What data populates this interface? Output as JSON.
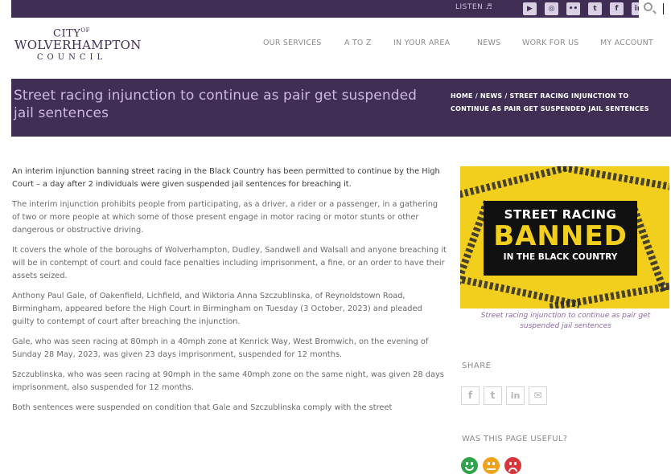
{
  "topbar": {
    "listen_label": "LISTEN",
    "socials": [
      {
        "name": "youtube-icon",
        "glyph": "▶"
      },
      {
        "name": "instagram-icon",
        "glyph": "◎"
      },
      {
        "name": "flickr-icon",
        "glyph": "••"
      },
      {
        "name": "twitter-icon",
        "glyph": "t"
      },
      {
        "name": "facebook-icon",
        "glyph": "f"
      },
      {
        "name": "linkedin-icon",
        "glyph": "in"
      }
    ]
  },
  "logo": {
    "line1": "CITY",
    "line1_of": "OF",
    "line2": "WOLVERHAMPTON",
    "line3": "COUNCIL"
  },
  "nav": {
    "items": [
      "OUR SERVICES",
      "A TO Z",
      "IN YOUR AREA",
      "NEWS",
      "WORK FOR US",
      "MY ACCOUNT"
    ]
  },
  "banner": {
    "title": "Street racing injunction to continue as pair get suspended jail sentences",
    "breadcrumb": "HOME  /  NEWS  /  STREET RACING INJUNCTION TO CONTINUE AS PAIR GET SUSPENDED JAIL SENTENCES"
  },
  "article": {
    "paragraphs": [
      "An interim injunction banning street racing in the Black Country has been permitted to continue by the High Court – a day after 2 individuals were given suspended jail sentences for breaching it.",
      "The interim injunction prohibits people from participating, as a driver, a rider or a passenger, in a gathering of two or more people at which some of those present engage in motor racing or motor stunts or other dangerous or obstructive driving.",
      "It covers the whole of the boroughs of Wolverhampton, Dudley, Sandwell and Walsall and anyone breaching it will be in contempt of court and could face penalties including imprisonment, a fine, or an order to have their assets seized.",
      "Anthony Paul Gale, of Oakenfield, Lichfield, and Wiktoria Anna Szczublinska, of Reynoldstown Road, Birmingham, appeared before the High Court in Birmingham on Tuesday (3 October, 2023) and pleaded guilty to contempt of court after breaching the injunction.",
      "Gale, who was seen racing at 80mph in a 40mph zone at Kenrick Way, West Bromwich, on the evening of Sunday 28 May, 2023, was given 23 days imprisonment, suspended for 12 months.",
      "Szczublinska, who was seen racing at 90mph in the same 40mph zone on the same night, was given 28 days imprisonment, also suspended for 12 months.",
      "Both sentences were suspended on condition that Gale and Szczublinska comply with the street"
    ]
  },
  "figure": {
    "line1": "STREET RACING",
    "line2": "BANNED",
    "line3": "IN THE BLACK COUNTRY",
    "caption": "Street racing injunction to continue as pair get suspended jail sentences"
  },
  "share": {
    "label": "SHARE",
    "buttons": [
      {
        "name": "facebook-share-icon",
        "glyph": "f"
      },
      {
        "name": "twitter-share-icon",
        "glyph": "t"
      },
      {
        "name": "linkedin-share-icon",
        "glyph": "in"
      },
      {
        "name": "email-share-icon",
        "glyph": "✉"
      }
    ]
  },
  "feedback": {
    "label": "WAS THIS PAGE USEFUL?"
  },
  "colors": {
    "brand_purple": "#402e55",
    "banner_title": "#cdb9e0",
    "figure_yellow": "#f3cf1d"
  }
}
